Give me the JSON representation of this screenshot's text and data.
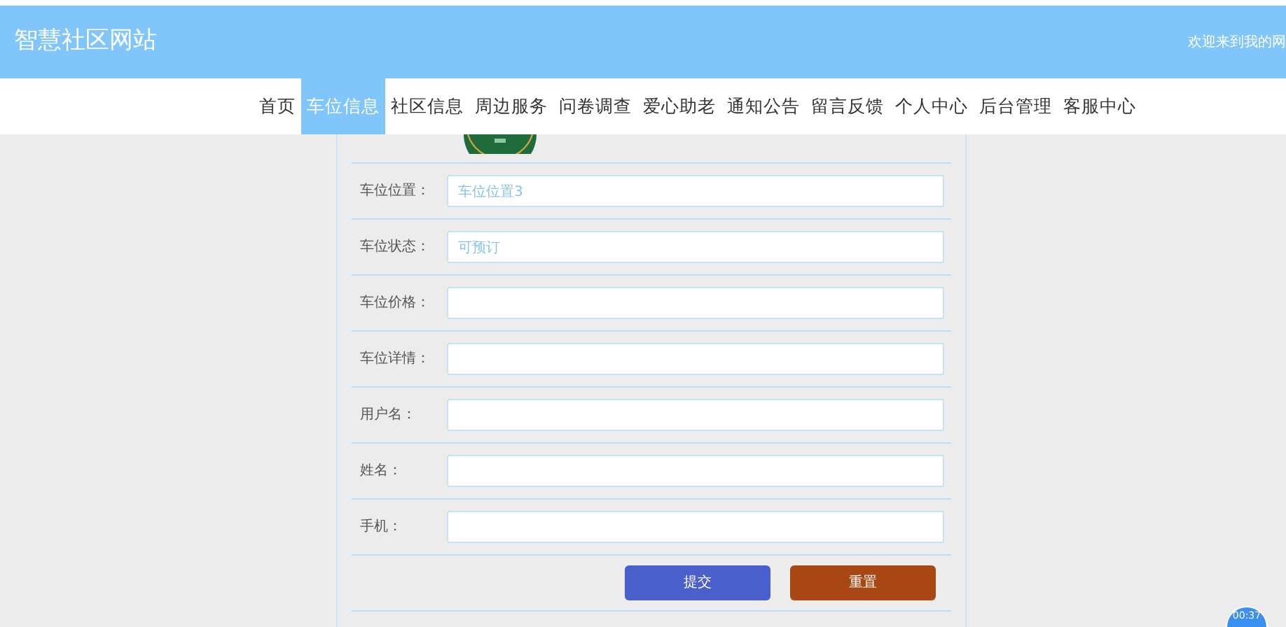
{
  "header": {
    "title": "智慧社区网站",
    "welcome": "欢迎来到我的网"
  },
  "nav": [
    {
      "label": "首页",
      "selected": false
    },
    {
      "label": "车位信息",
      "selected": true
    },
    {
      "label": "社区信息",
      "selected": false
    },
    {
      "label": "周边服务",
      "selected": false
    },
    {
      "label": "问卷调查",
      "selected": false
    },
    {
      "label": "爱心助老",
      "selected": false
    },
    {
      "label": "通知公告",
      "selected": false
    },
    {
      "label": "留言反馈",
      "selected": false
    },
    {
      "label": "个人中心",
      "selected": false
    },
    {
      "label": "后台管理",
      "selected": false
    },
    {
      "label": "客服中心",
      "selected": false
    }
  ],
  "form": {
    "fields": [
      {
        "label": "车位位置：",
        "value": "车位位置3"
      },
      {
        "label": "车位状态：",
        "value": "可预订"
      },
      {
        "label": "车位价格："
      },
      {
        "label": "车位详情："
      },
      {
        "label": "用户名："
      },
      {
        "label": "姓名："
      },
      {
        "label": "手机："
      }
    ],
    "buttons": [
      {
        "label": "提交",
        "kind": "submit"
      },
      {
        "label": "重置",
        "kind": "reset"
      }
    ]
  },
  "timer": "00:37"
}
